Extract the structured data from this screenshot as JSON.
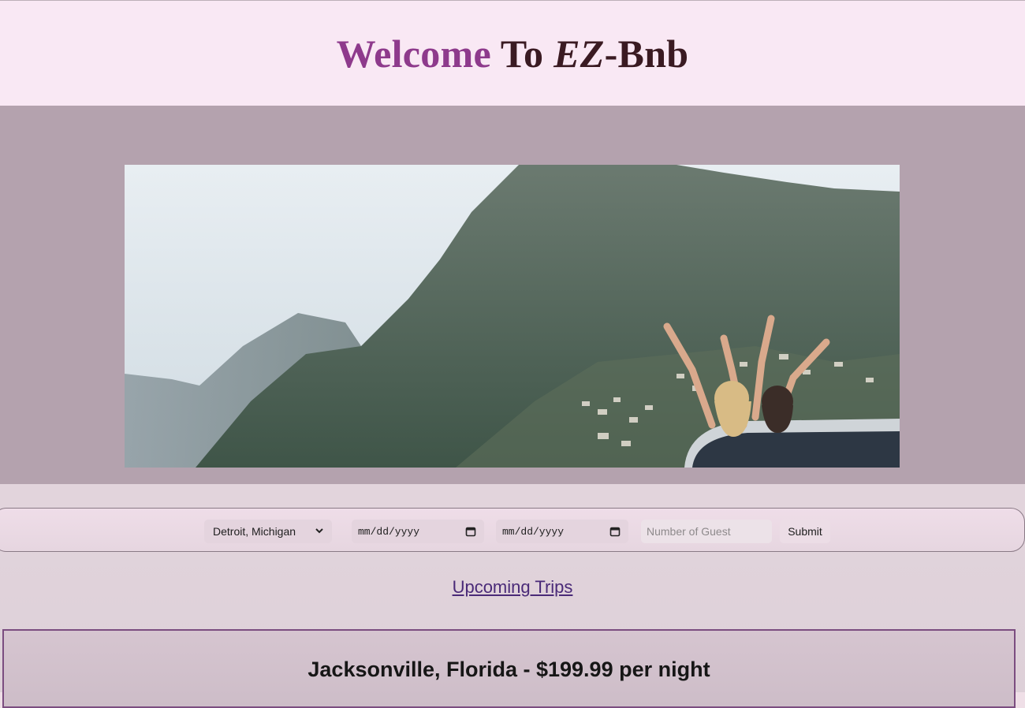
{
  "header": {
    "title_welcome": "Welcome",
    "title_to": " To ",
    "title_ez": "EZ",
    "title_bnb": "-Bnb"
  },
  "booking_form": {
    "location_value": "Detroit, Michigan",
    "check_in_placeholder": "mm/dd/yyyy",
    "check_out_placeholder": "mm/dd/yyyy",
    "guests_placeholder": "Number of Guest",
    "submit_label": "Submit"
  },
  "upcoming_trips_link": "Upcoming Trips",
  "listing": {
    "title": "Jacksonville, Florida - $199.99 per night"
  },
  "icons": {
    "select_arrow": "chevron-down-icon",
    "date_picker": "calendar-icon"
  },
  "colors": {
    "accent": "#8e3a8c",
    "header_bg": "#f9e8f4",
    "hero_bg": "#b4a2ae",
    "link": "#4a2a78",
    "card_border": "#7b4d80"
  }
}
